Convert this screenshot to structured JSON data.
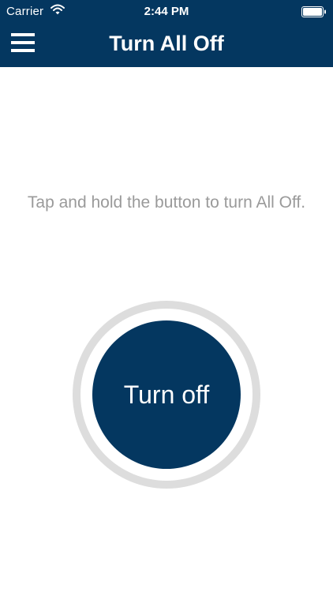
{
  "status_bar": {
    "carrier": "Carrier",
    "time": "2:44 PM",
    "wifi_icon": "wifi-icon",
    "battery_icon": "battery-icon"
  },
  "nav": {
    "title": "Turn All Off",
    "menu_icon": "hamburger-menu-icon"
  },
  "main": {
    "instruction": "Tap and hold the button to turn All Off.",
    "button_label": "Turn off"
  },
  "colors": {
    "brand_navy": "#043760",
    "ring_gray": "#dddddd",
    "instruction_gray": "#9a9a9a",
    "background": "#ffffff"
  }
}
